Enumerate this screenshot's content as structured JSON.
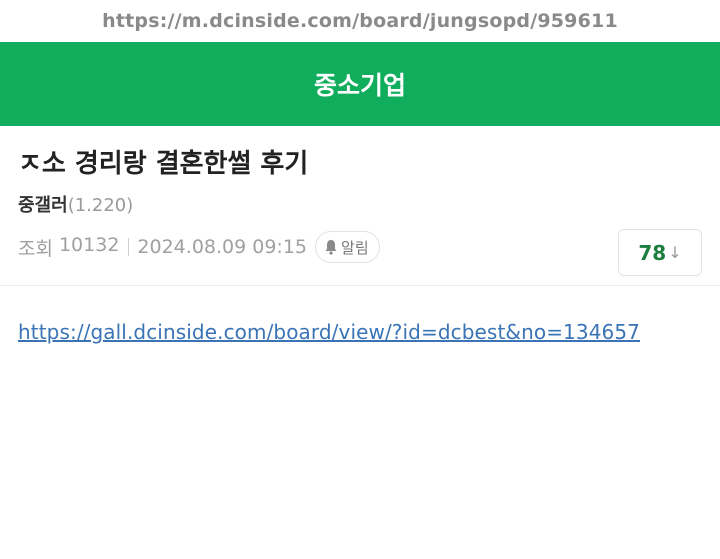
{
  "browser": {
    "url": "https://m.dcinside.com/board/jungsopd/959611"
  },
  "header": {
    "title": "중소기업",
    "bg_color": "#10ad5c"
  },
  "post": {
    "title": "ㅈ소 경리랑 결혼한썰 후기",
    "author_name": "중갤러",
    "author_ip": "(1.220)",
    "views_label": "조회",
    "views_count": "10132",
    "datetime": "2024.08.09 09:15",
    "alarm_label": "알림",
    "recommend_count": "78",
    "recommend_arrow": "↓"
  },
  "content": {
    "link_text": "https://gall.dcinside.com/board/view/?id=dcbest&no=134657"
  }
}
